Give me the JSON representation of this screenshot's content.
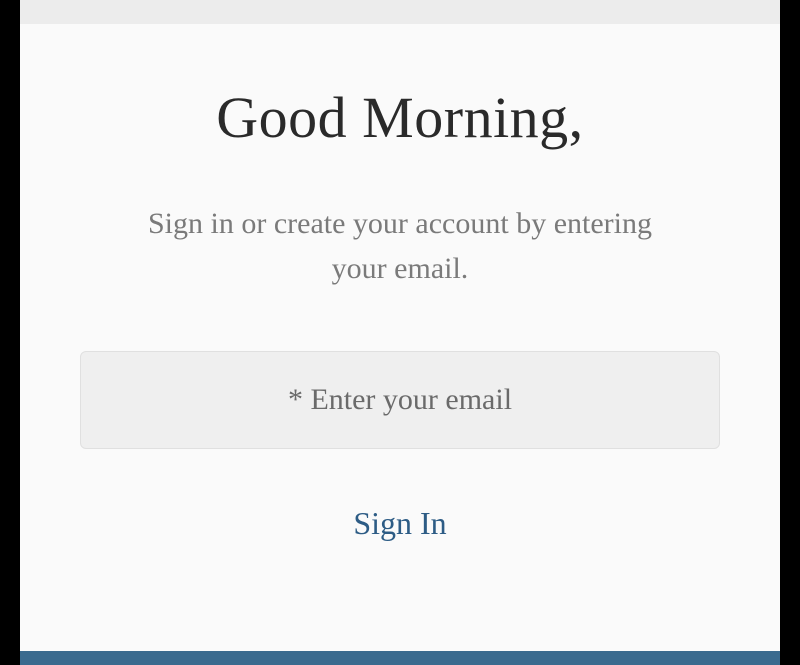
{
  "greeting": "Good Morning,",
  "subtitle": "Sign in or create your account by entering your email.",
  "email": {
    "placeholder": "* Enter your email",
    "value": ""
  },
  "signInLabel": "Sign In"
}
